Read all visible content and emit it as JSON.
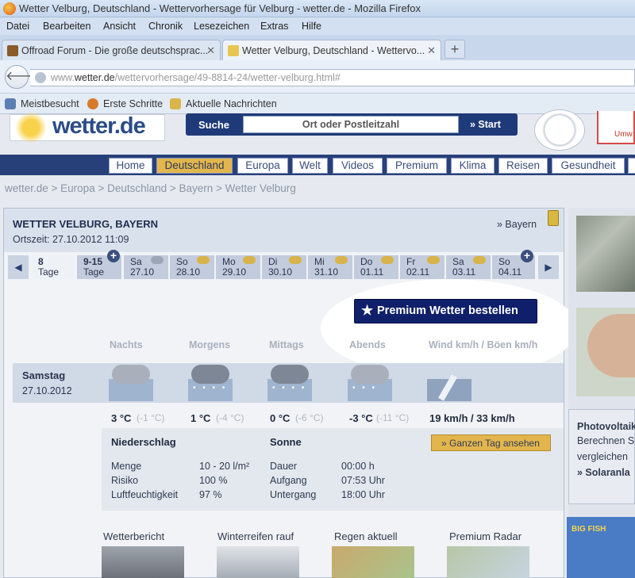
{
  "window": {
    "title": "Wetter Velburg, Deutschland - Wettervorhersage für Velburg - wetter.de - Mozilla Firefox"
  },
  "menu": [
    "Datei",
    "Bearbeiten",
    "Ansicht",
    "Chronik",
    "Lesezeichen",
    "Extras",
    "Hilfe"
  ],
  "tabs": [
    {
      "label": "Offroad Forum - Die große deutschsprac..."
    },
    {
      "label": "Wetter Velburg, Deutschland - Wettervo..."
    }
  ],
  "url": {
    "prefix": "www.",
    "domain": "wetter.de",
    "path": "/wettervorhersage/49-8814-24/wetter-velburg.html#"
  },
  "bookmarks": [
    "Meistbesucht",
    "Erste Schritte",
    "Aktuelle Nachrichten"
  ],
  "site": {
    "logo": "wetter.de",
    "search_label": "Suche",
    "search_placeholder": "Ort oder Postleitzahl",
    "search_button": "» Start",
    "badge2_text": "Umw"
  },
  "nav": [
    "Home",
    "Deutschland",
    "Europa",
    "Welt",
    "Videos",
    "Premium",
    "Klima",
    "Reisen",
    "Gesundheit"
  ],
  "breadcrumb": "wetter.de > Europa > Deutschland > Bayern > Wetter Velburg",
  "location": {
    "title": "WETTER VELBURG, BAYERN",
    "time": "Ortszeit: 27.10.2012 11:09",
    "region_link": "» Bayern"
  },
  "days": [
    {
      "a": "8",
      "b": "Tage"
    },
    {
      "a": "9-15",
      "b": "Tage"
    },
    {
      "a": "Sa",
      "b": "27.10"
    },
    {
      "a": "So",
      "b": "28.10"
    },
    {
      "a": "Mo",
      "b": "29.10"
    },
    {
      "a": "Di",
      "b": "30.10"
    },
    {
      "a": "Mi",
      "b": "31.10"
    },
    {
      "a": "Do",
      "b": "01.11"
    },
    {
      "a": "Fr",
      "b": "02.11"
    },
    {
      "a": "Sa",
      "b": "03.11"
    },
    {
      "a": "So",
      "b": "04.11"
    }
  ],
  "premium_button": "Premium Wetter bestellen",
  "columns": [
    "Nachts",
    "Morgens",
    "Mittags",
    "Abends",
    "Wind km/h / Böen km/h"
  ],
  "today": {
    "name": "Samstag",
    "date": "27.10.2012",
    "temps": [
      {
        "t": "3 °C",
        "f": "(-1 °C)"
      },
      {
        "t": "1 °C",
        "f": "(-4 °C)"
      },
      {
        "t": "0 °C",
        "f": "(-6 °C)"
      },
      {
        "t": "-3 °C",
        "f": "(-11 °C)"
      }
    ],
    "wind": "19 km/h / 33 km/h"
  },
  "details": {
    "niederschlag_title": "Niederschlag",
    "sonne_title": "Sonne",
    "ganzen_tag": "» Ganzen Tag ansehen",
    "left": [
      {
        "k": "Menge",
        "v": "10 - 20 l/m²"
      },
      {
        "k": "Risiko",
        "v": "100 %"
      },
      {
        "k": "Luftfeuchtigkeit",
        "v": "97 %"
      }
    ],
    "right": [
      {
        "k": "Dauer",
        "v": "00:00 h"
      },
      {
        "k": "Aufgang",
        "v": "07:53 Uhr"
      },
      {
        "k": "Untergang",
        "v": "18:00 Uhr"
      }
    ]
  },
  "teasers": [
    "Wetterbericht",
    "Winterreifen rauf",
    "Regen aktuell",
    "Premium Radar"
  ],
  "sidebar": {
    "box_title": "Photovoltaik",
    "line1": "Berechnen S",
    "line2": "vergleichen",
    "link": "» Solaranla",
    "ad_text": "BIG FISH"
  }
}
